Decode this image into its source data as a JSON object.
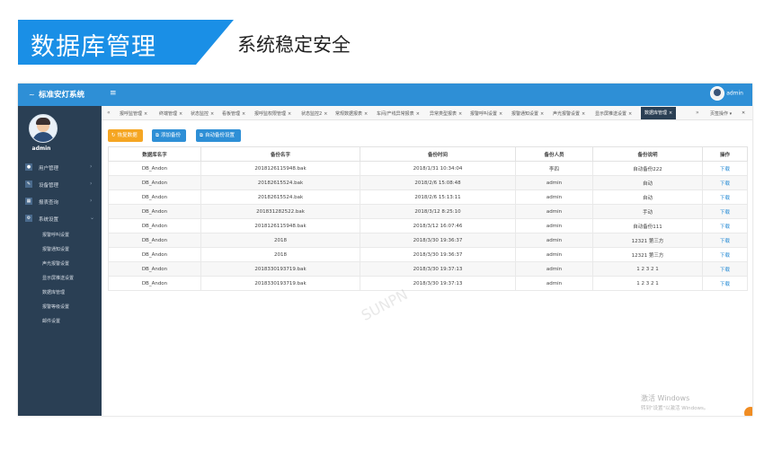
{
  "banner": {
    "title": "数据库管理",
    "subtitle": "系统稳定安全"
  },
  "app": {
    "logo": "标准安灯系统",
    "menu_toggle": "≡",
    "user_name": "admin"
  },
  "sidebar": {
    "username": "admin",
    "items": [
      {
        "label": "用户管理",
        "icon": "user-icon"
      },
      {
        "label": "设备管理",
        "icon": "wrench-icon"
      },
      {
        "label": "报表查询",
        "icon": "chart-icon"
      },
      {
        "label": "系统设置",
        "icon": "settings-icon"
      }
    ],
    "subitems": [
      "报警呼叫设置",
      "报警通知设置",
      "声光报警设置",
      "显示屏推送设置",
      "数据库管理",
      "报警等级设置",
      "邮件设置"
    ]
  },
  "tabs": {
    "items": [
      "报呼监管理",
      "终端管理",
      "状态监控",
      "看板管理",
      "报呼监权限管理",
      "状态监控2",
      "常规数据报表",
      "车间/产线异常报表",
      "异常类型报表",
      "报警呼叫设置",
      "报警通知设置",
      "声光报警设置",
      "显示屏推送设置",
      "数据库管理"
    ],
    "close": "×",
    "prev": "«",
    "next": "»",
    "page_ops": "页签操作 ▾",
    "collapse": "✕"
  },
  "toolbar": {
    "restore": "恢复数据",
    "add": "添加备份",
    "auto": "自动备份设置",
    "restore_icon": "↻",
    "add_icon": "⧉",
    "auto_icon": "⧉"
  },
  "table": {
    "headers": [
      "数据库名字",
      "备份名字",
      "备份时间",
      "备份人员",
      "备份说明",
      "操作"
    ],
    "rows": [
      [
        "DB_Andon",
        "2018126115948.bak",
        "2018/1/31 10:34:04",
        "李四",
        "自动备份222",
        "下载"
      ],
      [
        "DB_Andon",
        "20182615524.bak",
        "2018/2/6 15:08:48",
        "admin",
        "自动",
        "下载"
      ],
      [
        "DB_Andon",
        "20182615524.bak",
        "2018/2/6 15:13:11",
        "admin",
        "自动",
        "下载"
      ],
      [
        "DB_Andon",
        "201831282522.bak",
        "2018/3/12 8:25:10",
        "admin",
        "手动",
        "下载"
      ],
      [
        "DB_Andon",
        "2018126115948.bak",
        "2018/3/12 16:07:46",
        "admin",
        "自动备份111",
        "下载"
      ],
      [
        "DB_Andon",
        "2018",
        "2018/3/30 19:36:37",
        "admin",
        "12321 第三方",
        "下载"
      ],
      [
        "DB_Andon",
        "2018",
        "2018/3/30 19:36:37",
        "admin",
        "12321 第三方",
        "下载"
      ],
      [
        "DB_Andon",
        "2018330193719.bak",
        "2018/3/30 19:37:13",
        "admin",
        "1 2 3 2 1",
        "下载"
      ],
      [
        "DB_Andon",
        "2018330193719.bak",
        "2018/3/30 19:37:13",
        "admin",
        "1 2 3 2 1",
        "下载"
      ]
    ]
  },
  "watermark": "SUNPN",
  "windows_activation": {
    "line1": "激活 Windows",
    "line2": "转到\"设置\"以激活 Windows。"
  },
  "colors": {
    "accent": "#2e8fd6",
    "banner": "#1a8fe6",
    "sidebar": "#2a3f54",
    "restore_button": "#f5a623"
  }
}
